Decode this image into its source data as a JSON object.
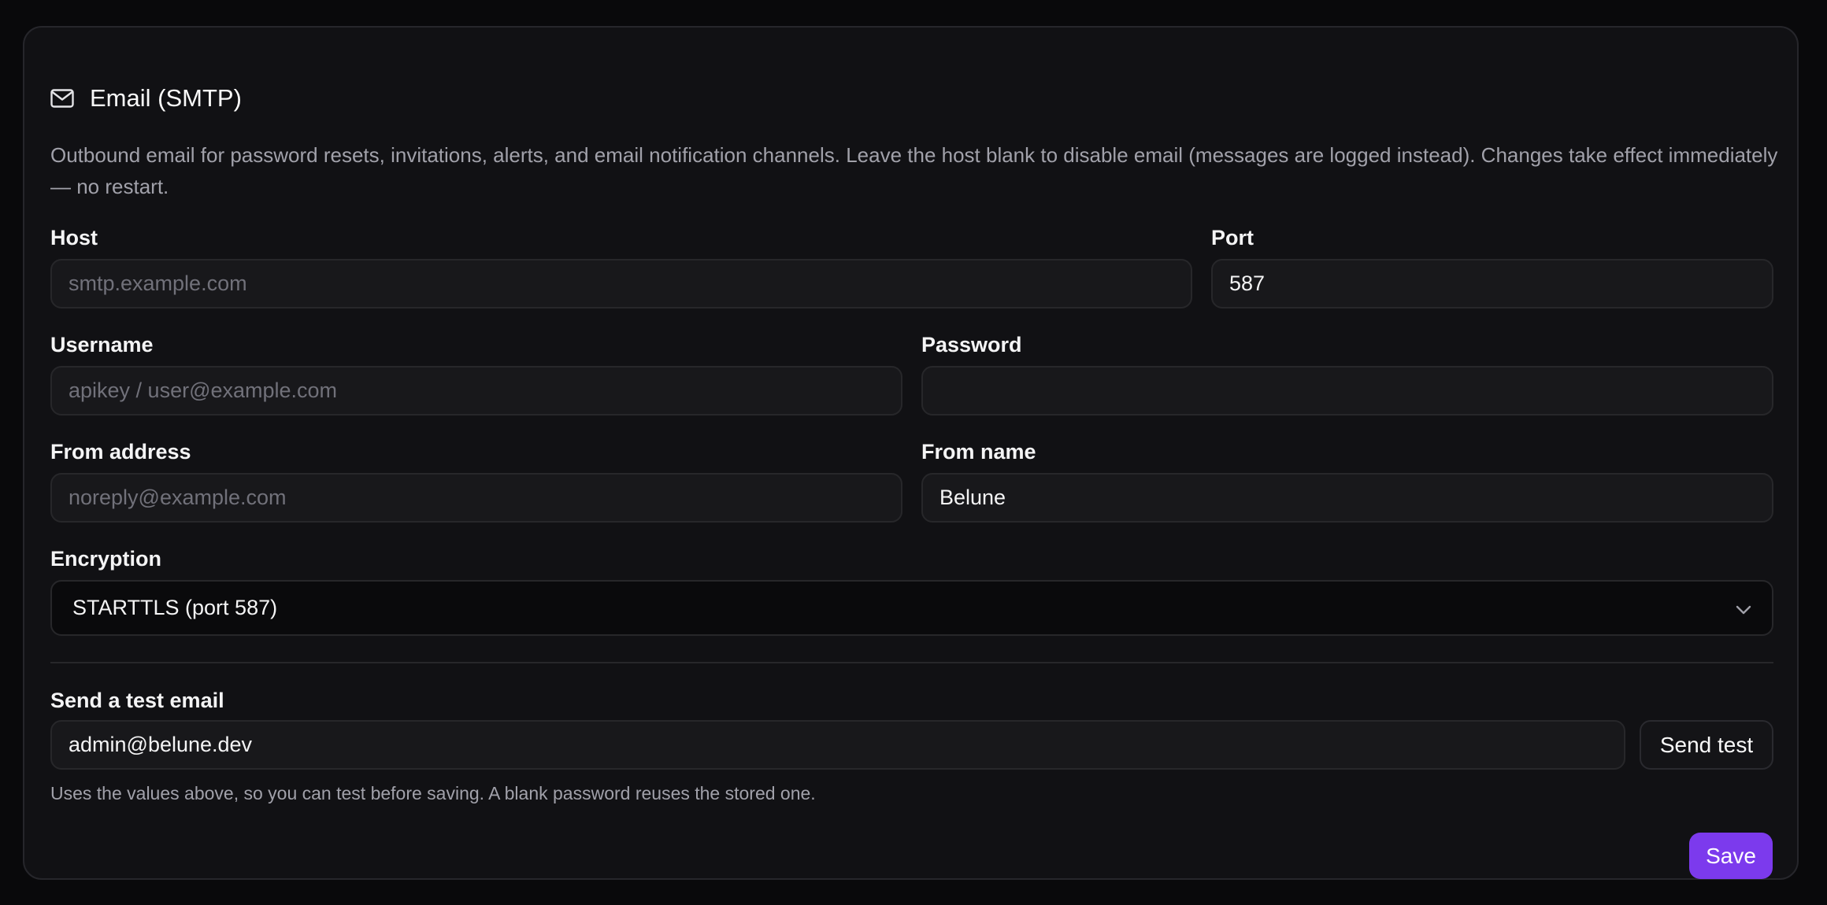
{
  "section": {
    "title": "Email (SMTP)",
    "icon": "mail-icon",
    "description": "Outbound email for password resets, invitations, alerts, and email notification channels. Leave the host blank to disable email (messages are logged instead). Changes take effect immediately — no restart."
  },
  "fields": {
    "host": {
      "label": "Host",
      "value": "",
      "placeholder": "smtp.example.com"
    },
    "port": {
      "label": "Port",
      "value": "587",
      "placeholder": ""
    },
    "username": {
      "label": "Username",
      "value": "",
      "placeholder": "apikey / user@example.com"
    },
    "password": {
      "label": "Password",
      "value": "",
      "placeholder": ""
    },
    "from_address": {
      "label": "From address",
      "value": "",
      "placeholder": "noreply@example.com"
    },
    "from_name": {
      "label": "From name",
      "value": "Belune",
      "placeholder": ""
    },
    "encryption": {
      "label": "Encryption",
      "selected": "STARTTLS (port 587)"
    }
  },
  "test": {
    "label": "Send a test email",
    "value": "admin@belune.dev",
    "button_label": "Send test",
    "hint": "Uses the values above, so you can test before saving. A blank password reuses the stored one."
  },
  "actions": {
    "save_label": "Save"
  },
  "colors": {
    "accent": "#7c3aed",
    "background": "#09090b",
    "card": "#111114"
  }
}
